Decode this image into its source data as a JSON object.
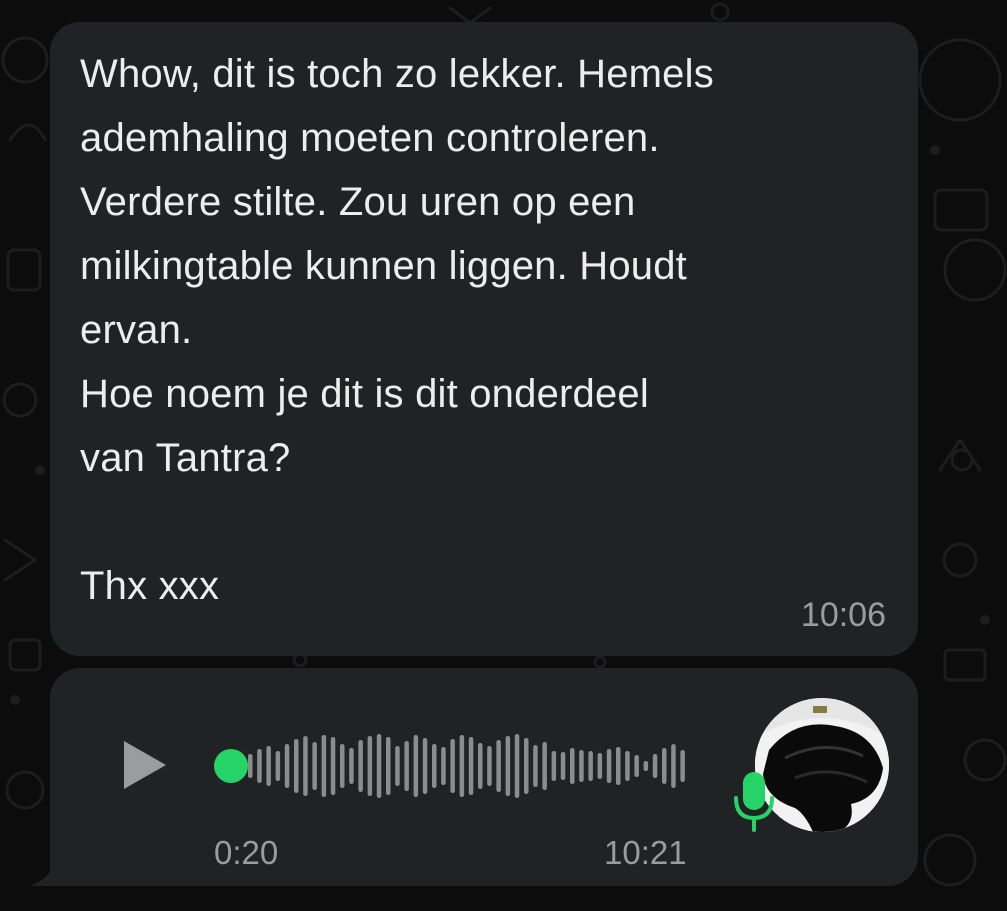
{
  "messages": [
    {
      "text": "Whow, dit is toch zo lekker. Hemels\nademhaling moeten controleren.\nVerdere stilte. Zou uren op een\nmilkingtable kunnen liggen. Houdt\nervan.\nHoe noem je dit is dit onderdeel\nvan Tantra?\n\nThx xxx",
      "time": "10:06"
    }
  ],
  "voice_message": {
    "duration": "0:20",
    "time": "10:21",
    "progress": 0.0,
    "play_icon": "play-icon",
    "mic_icon": "microphone-icon"
  },
  "colors": {
    "bubble": "#202324",
    "text": "#ededed",
    "meta_text": "#9a9c9d",
    "accent_green": "#25d366",
    "waveform": "#8a8c8d",
    "background": "#0c0c0c"
  }
}
